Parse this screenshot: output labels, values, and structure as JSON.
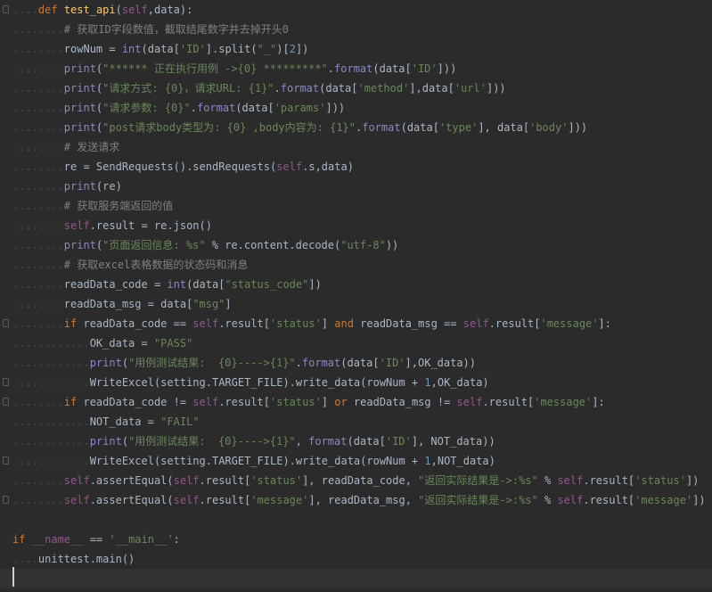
{
  "editor": {
    "lines": [
      {
        "indent": "....",
        "text": "def test_api(self,data):",
        "fold": true
      },
      {
        "indent": "........",
        "text": "# 获取ID字段数值，截取结尾数字并去掉开头0",
        "fold": false
      },
      {
        "indent": "........",
        "text": "rowNum = int(data['ID'].split(\"_\")[2])",
        "fold": false
      },
      {
        "indent": "........",
        "text": "print(\"****** 正在执行用例 ->{0} *********\".format(data['ID']))",
        "fold": false
      },
      {
        "indent": "........",
        "text": "print(\"请求方式: {0}，请求URL: {1}\".format(data['method'],data['url']))",
        "fold": false
      },
      {
        "indent": "........",
        "text": "print(\"请求参数: {0}\".format(data['params']))",
        "fold": false
      },
      {
        "indent": "........",
        "text": "print(\"post请求body类型为: {0} ,body内容为: {1}\".format(data['type'], data['body']))",
        "fold": false
      },
      {
        "indent": "........",
        "text": "# 发送请求",
        "fold": false
      },
      {
        "indent": "........",
        "text": "re = SendRequests().sendRequests(self.s,data)",
        "fold": false
      },
      {
        "indent": "........",
        "text": "print(re)",
        "fold": false
      },
      {
        "indent": "........",
        "text": "# 获取服务端返回的值",
        "fold": false
      },
      {
        "indent": "........",
        "text": "self.result = re.json()",
        "fold": false
      },
      {
        "indent": "........",
        "text": "print(\"页面返回信息: %s\" % re.content.decode(\"utf-8\"))",
        "fold": false
      },
      {
        "indent": "........",
        "text": "# 获取excel表格数据的状态码和消息",
        "fold": false
      },
      {
        "indent": "........",
        "text": "readData_code = int(data[\"status_code\"])",
        "fold": false
      },
      {
        "indent": "........",
        "text": "readData_msg = data[\"msg\"]",
        "fold": false
      },
      {
        "indent": "........",
        "text": "if readData_code == self.result['status'] and readData_msg == self.result['message']:",
        "fold": true
      },
      {
        "indent": "............",
        "text": "OK_data = \"PASS\"",
        "fold": false
      },
      {
        "indent": "............",
        "text": "print(\"用例测试结果:  {0}---->{1}\".format(data['ID'],OK_data))",
        "fold": false
      },
      {
        "indent": "............",
        "text": "WriteExcel(setting.TARGET_FILE).write_data(rowNum + 1,OK_data)",
        "fold": true
      },
      {
        "indent": "........",
        "text": "if readData_code != self.result['status'] or readData_msg != self.result['message']:",
        "fold": true
      },
      {
        "indent": "............",
        "text": "NOT_data = \"FAIL\"",
        "fold": false
      },
      {
        "indent": "............",
        "text": "print(\"用例测试结果:  {0}---->{1}\", format(data['ID'], NOT_data))",
        "fold": false
      },
      {
        "indent": "............",
        "text": "WriteExcel(setting.TARGET_FILE).write_data(rowNum + 1,NOT_data)",
        "fold": true
      },
      {
        "indent": "........",
        "text": "self.assertEqual(self.result['status'], readData_code, \"返回实际结果是->:%s\" % self.result['status'])",
        "fold": false
      },
      {
        "indent": "........",
        "text": "self.assertEqual(self.result['message'], readData_msg, \"返回实际结果是->:%s\" % self.result['message'])",
        "fold": true
      },
      {
        "indent": "",
        "text": "",
        "fold": false
      },
      {
        "indent": "",
        "text": "if __name__ == '__main__':",
        "fold": false
      },
      {
        "indent": "....",
        "text": "unittest.main()",
        "fold": false
      },
      {
        "indent": "",
        "text": "",
        "fold": false
      }
    ]
  },
  "colors": {
    "background": "#2b2b2b",
    "keyword": "#cc7832",
    "string": "#6a8759",
    "comment": "#808080",
    "self": "#94558d",
    "number": "#6897bb",
    "function": "#ffc66d",
    "builtin": "#8888c6",
    "text": "#a9b7c6",
    "current_line": "#323232"
  }
}
